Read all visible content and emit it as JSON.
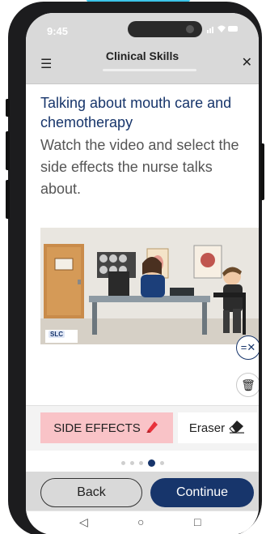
{
  "status_bar": {
    "time": "9:45",
    "icons": "signal-wifi-battery"
  },
  "header": {
    "title": "Clinical Skills",
    "menu_icon": "menu-icon",
    "close_icon": "close-icon"
  },
  "content": {
    "lesson_title": "Talking about mouth care and chemotherapy",
    "instructions": "Watch the video and select the side effects the nurse talks about.",
    "video_logo": "SLC"
  },
  "tools": {
    "clear_icon": "clear-format-icon",
    "delete_icon": "trash-icon"
  },
  "tags": {
    "side_effects_label": "SIDE EFFECTS",
    "side_effects_color": "#f9c3c7",
    "eraser_label": "Eraser"
  },
  "pagination": {
    "total": 5,
    "active": 4
  },
  "footer": {
    "back_label": "Back",
    "continue_label": "Continue",
    "accent": "#17356b"
  },
  "android_nav": {
    "back": "◁",
    "home": "○",
    "recents": "□"
  }
}
